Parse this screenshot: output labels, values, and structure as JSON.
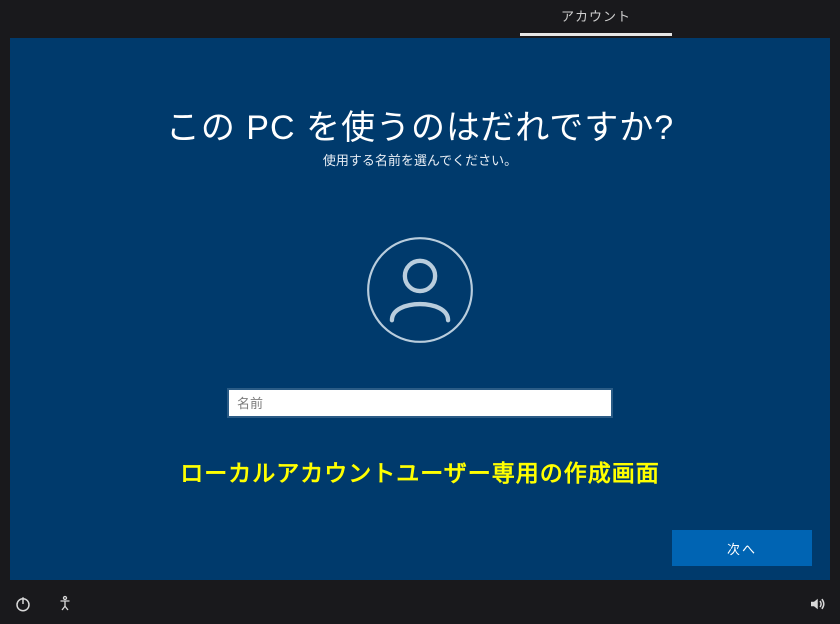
{
  "topbar": {
    "active_tab_label": "アカウント"
  },
  "main": {
    "heading": "この PC を使うのはだれですか?",
    "subheading": "使用する名前を選んでください。",
    "name_input": {
      "placeholder": "名前",
      "value": ""
    },
    "annotation": "ローカルアカウントユーザー専用の作成画面",
    "next_button_label": "次へ"
  },
  "icons": {
    "avatar": "user-icon",
    "power": "power-icon",
    "accessibility": "accessibility-icon",
    "volume": "volume-icon"
  },
  "colors": {
    "stage_bg": "#003a6c",
    "accent": "#0064b3",
    "annotation": "#ffff00"
  }
}
